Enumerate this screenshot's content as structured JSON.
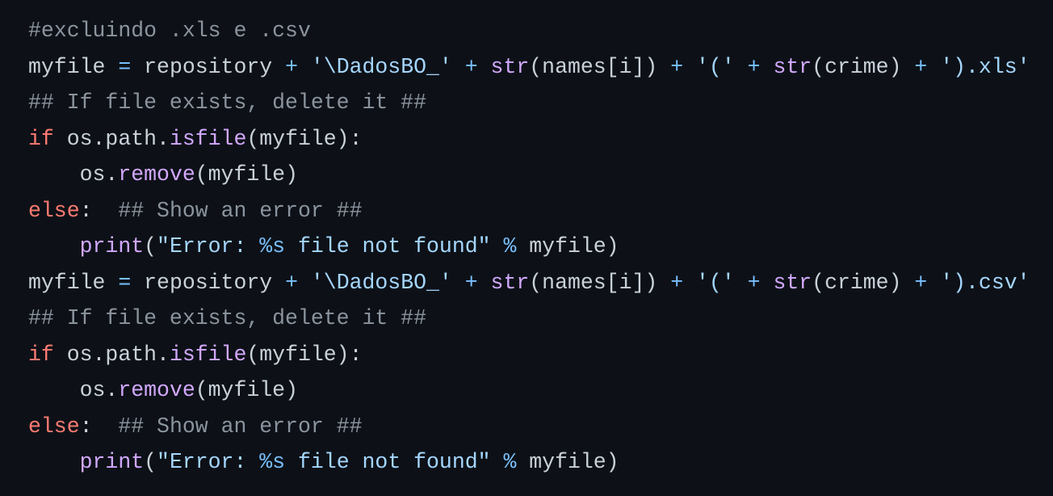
{
  "code": {
    "language": "python",
    "lines": [
      [
        {
          "type": "comment",
          "text": "#excluindo .xls e .csv"
        }
      ],
      [
        {
          "type": "plain",
          "text": "myfile "
        },
        {
          "type": "operator",
          "text": "="
        },
        {
          "type": "plain",
          "text": " repository "
        },
        {
          "type": "operator",
          "text": "+"
        },
        {
          "type": "plain",
          "text": " "
        },
        {
          "type": "string",
          "text": "'\\DadosBO_'"
        },
        {
          "type": "plain",
          "text": " "
        },
        {
          "type": "operator",
          "text": "+"
        },
        {
          "type": "plain",
          "text": " "
        },
        {
          "type": "builtin",
          "text": "str"
        },
        {
          "type": "plain",
          "text": "(names[i]) "
        },
        {
          "type": "operator",
          "text": "+"
        },
        {
          "type": "plain",
          "text": " "
        },
        {
          "type": "string",
          "text": "'('"
        },
        {
          "type": "plain",
          "text": " "
        },
        {
          "type": "operator",
          "text": "+"
        },
        {
          "type": "plain",
          "text": " "
        },
        {
          "type": "builtin",
          "text": "str"
        },
        {
          "type": "plain",
          "text": "(crime) "
        },
        {
          "type": "operator",
          "text": "+"
        },
        {
          "type": "plain",
          "text": " "
        },
        {
          "type": "string",
          "text": "').xls'"
        }
      ],
      [
        {
          "type": "comment",
          "text": "## If file exists, delete it ##"
        }
      ],
      [
        {
          "type": "keyword",
          "text": "if"
        },
        {
          "type": "plain",
          "text": " os.path."
        },
        {
          "type": "function",
          "text": "isfile"
        },
        {
          "type": "plain",
          "text": "(myfile):"
        }
      ],
      [
        {
          "type": "plain",
          "text": "    os."
        },
        {
          "type": "function",
          "text": "remove"
        },
        {
          "type": "plain",
          "text": "(myfile)"
        }
      ],
      [
        {
          "type": "keyword",
          "text": "else"
        },
        {
          "type": "plain",
          "text": ":  "
        },
        {
          "type": "comment",
          "text": "## Show an error ##"
        }
      ],
      [
        {
          "type": "plain",
          "text": "    "
        },
        {
          "type": "builtin",
          "text": "print"
        },
        {
          "type": "plain",
          "text": "("
        },
        {
          "type": "string",
          "text": "\"Error: "
        },
        {
          "type": "format",
          "text": "%s"
        },
        {
          "type": "string",
          "text": " file not found\""
        },
        {
          "type": "plain",
          "text": " "
        },
        {
          "type": "operator",
          "text": "%"
        },
        {
          "type": "plain",
          "text": " myfile)"
        }
      ],
      [
        {
          "type": "plain",
          "text": "myfile "
        },
        {
          "type": "operator",
          "text": "="
        },
        {
          "type": "plain",
          "text": " repository "
        },
        {
          "type": "operator",
          "text": "+"
        },
        {
          "type": "plain",
          "text": " "
        },
        {
          "type": "string",
          "text": "'\\DadosBO_'"
        },
        {
          "type": "plain",
          "text": " "
        },
        {
          "type": "operator",
          "text": "+"
        },
        {
          "type": "plain",
          "text": " "
        },
        {
          "type": "builtin",
          "text": "str"
        },
        {
          "type": "plain",
          "text": "(names[i]) "
        },
        {
          "type": "operator",
          "text": "+"
        },
        {
          "type": "plain",
          "text": " "
        },
        {
          "type": "string",
          "text": "'('"
        },
        {
          "type": "plain",
          "text": " "
        },
        {
          "type": "operator",
          "text": "+"
        },
        {
          "type": "plain",
          "text": " "
        },
        {
          "type": "builtin",
          "text": "str"
        },
        {
          "type": "plain",
          "text": "(crime) "
        },
        {
          "type": "operator",
          "text": "+"
        },
        {
          "type": "plain",
          "text": " "
        },
        {
          "type": "string",
          "text": "').csv'"
        }
      ],
      [
        {
          "type": "comment",
          "text": "## If file exists, delete it ##"
        }
      ],
      [
        {
          "type": "keyword",
          "text": "if"
        },
        {
          "type": "plain",
          "text": " os.path."
        },
        {
          "type": "function",
          "text": "isfile"
        },
        {
          "type": "plain",
          "text": "(myfile):"
        }
      ],
      [
        {
          "type": "plain",
          "text": "    os."
        },
        {
          "type": "function",
          "text": "remove"
        },
        {
          "type": "plain",
          "text": "(myfile)"
        }
      ],
      [
        {
          "type": "keyword",
          "text": "else"
        },
        {
          "type": "plain",
          "text": ":  "
        },
        {
          "type": "comment",
          "text": "## Show an error ##"
        }
      ],
      [
        {
          "type": "plain",
          "text": "    "
        },
        {
          "type": "builtin",
          "text": "print"
        },
        {
          "type": "plain",
          "text": "("
        },
        {
          "type": "string",
          "text": "\"Error: "
        },
        {
          "type": "format",
          "text": "%s"
        },
        {
          "type": "string",
          "text": " file not found\""
        },
        {
          "type": "plain",
          "text": " "
        },
        {
          "type": "operator",
          "text": "%"
        },
        {
          "type": "plain",
          "text": " myfile)"
        }
      ]
    ]
  },
  "colors": {
    "background": "#0d1117",
    "plain": "#c9d1d9",
    "comment": "#8b949e",
    "keyword": "#ff7b72",
    "operator": "#79c0ff",
    "string": "#a5d6ff",
    "builtin": "#d2a8ff"
  }
}
